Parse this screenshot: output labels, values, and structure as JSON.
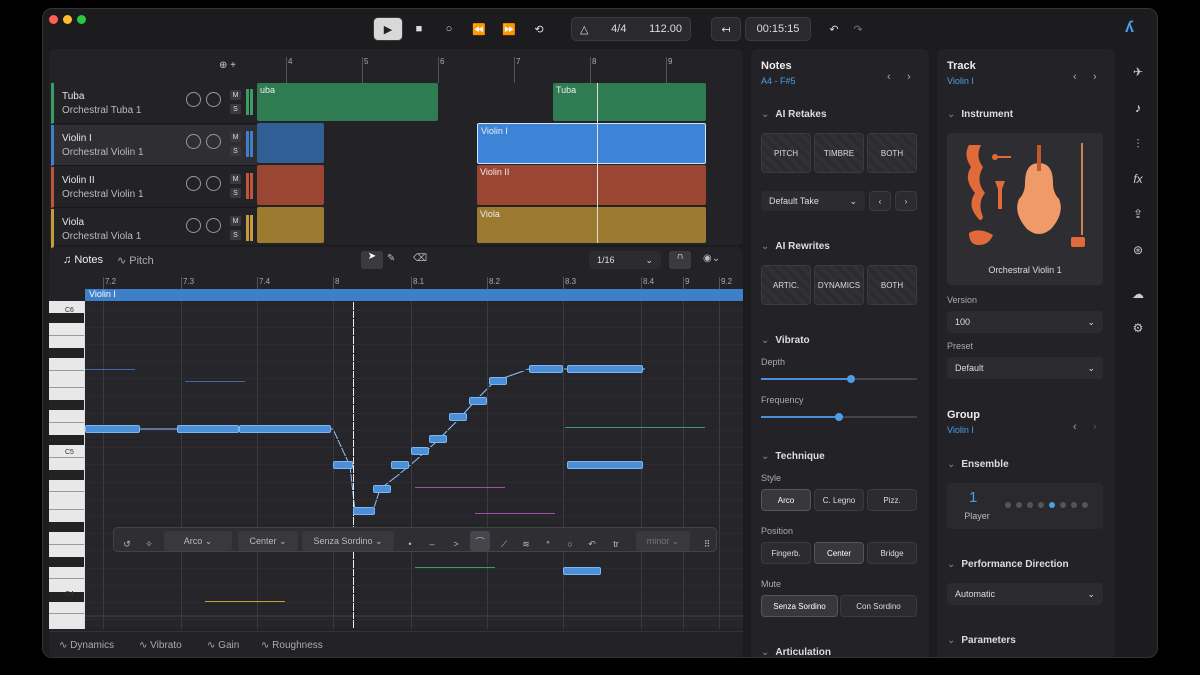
{
  "transport": {
    "time_signature": "4/4",
    "tempo": "112.00",
    "time": "00:15:15"
  },
  "tracks": [
    {
      "name": "Tuba",
      "instrument": "Orchestral Tuba 1",
      "color": "#3a9d62"
    },
    {
      "name": "Violin I",
      "instrument": "Orchestral Violin 1",
      "color": "#3d7fc9"
    },
    {
      "name": "Violin II",
      "instrument": "Orchestral Violin 1",
      "color": "#c0553a"
    },
    {
      "name": "Viola",
      "instrument": "Orchestral Viola 1",
      "color": "#c79a3a"
    }
  ],
  "track_buttons": {
    "mute": "M",
    "solo": "S"
  },
  "arrange_ruler": [
    "4",
    "5",
    "6",
    "7",
    "8",
    "9"
  ],
  "clips": {
    "tuba_a": "uba",
    "tuba_b": "Tuba",
    "violin1": "Violin I",
    "violin2": "Violin II",
    "viola": "Viola"
  },
  "editor": {
    "tab_notes": "Notes",
    "tab_pitch": "Pitch",
    "grid": "1/16",
    "lane_label": "Violin I",
    "ruler": [
      "7.2",
      "7.3",
      "7.4",
      "8",
      "8.1",
      "8.2",
      "8.3",
      "8.4",
      "9",
      "9.2"
    ],
    "keys": [
      "C6",
      "C5",
      "C4"
    ]
  },
  "note_toolbar": {
    "style": "Arco",
    "position": "Center",
    "mute": "Senza Sordino",
    "scale": "minor"
  },
  "bottom_tabs": [
    "Dynamics",
    "Vibrato",
    "Gain",
    "Roughness"
  ],
  "notes_panel": {
    "title": "Notes",
    "range": "A4 - F#5",
    "ai_retakes": "AI Retakes",
    "retake_buttons": [
      "PITCH",
      "TIMBRE",
      "BOTH"
    ],
    "take": "Default Take",
    "ai_rewrites": "AI Rewrites",
    "rewrite_buttons": [
      "ARTIC.",
      "DYNAMICS",
      "BOTH"
    ],
    "vibrato": "Vibrato",
    "depth": "Depth",
    "depth_value": 0.58,
    "frequency": "Frequency",
    "frequency_value": 0.5,
    "technique": "Technique",
    "style_label": "Style",
    "styles": [
      "Arco",
      "C. Legno",
      "Pizz."
    ],
    "position_label": "Position",
    "positions": [
      "Fingerb.",
      "Center",
      "Bridge"
    ],
    "mute_label": "Mute",
    "mutes": [
      "Senza Sordino",
      "Con Sordino"
    ],
    "articulation": "Articulation"
  },
  "track_panel": {
    "title": "Track",
    "track_name": "Violin I",
    "instrument_section": "Instrument",
    "instrument_name": "Orchestral Violin 1",
    "version_label": "Version",
    "version": "100",
    "preset_label": "Preset",
    "preset": "Default",
    "group": "Group",
    "group_name": "Violin I",
    "ensemble": "Ensemble",
    "player_count": "1",
    "player_label": "Player",
    "performance": "Performance Direction",
    "performance_value": "Automatic",
    "parameters": "Parameters"
  },
  "colors": {
    "accent": "#4a8fd8",
    "violin": "#3d7fc9"
  }
}
